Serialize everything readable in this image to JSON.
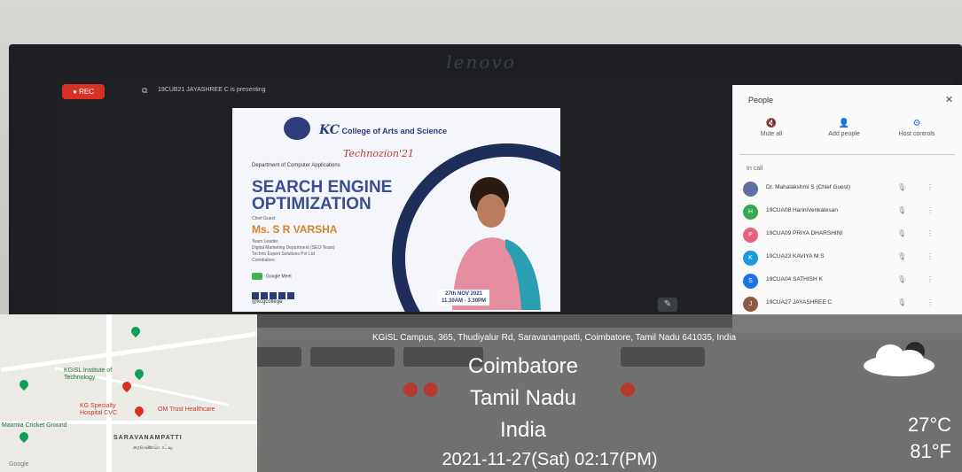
{
  "brand": "lenovo",
  "meet": {
    "rec_label": "● REC",
    "presenting_text": "19CUB21 JAYASHREE C is presenting"
  },
  "poster": {
    "college_short": "KC",
    "college_name": "College of Arts and Science",
    "event": "Technozion'21",
    "department": "Department of Computer Applications",
    "title_line1": "SEARCH ENGINE",
    "title_line2": "OPTIMIZATION",
    "chief_guest_label": "Chief Guest",
    "speaker": "Ms. S R VARSHA",
    "speaker_role": "Team Leader",
    "speaker_detail1": "Digital Marketing Department (SEO Team)",
    "speaker_detail2": "Techno Expert Solutions Pvt Ltd",
    "speaker_city": "Coimbatore",
    "platform": "Google Meet",
    "handle": "@kcgcollege",
    "date": "27th NOV 2021",
    "time": "11.30AM - 3.30PM"
  },
  "people_panel": {
    "title": "People",
    "actions": [
      {
        "icon": "mute-all-icon",
        "label": "Mute all"
      },
      {
        "icon": "add-people-icon",
        "label": "Add people"
      },
      {
        "icon": "host-controls-icon",
        "label": "Host controls"
      }
    ],
    "section_label": "In call",
    "participants": [
      {
        "name": "Dr. Mahalakshmi S (Chief Guest)",
        "initial": "",
        "color": "#5f6f9f"
      },
      {
        "name": "19CUA08 HariniVenkatesan",
        "initial": "H",
        "color": "#33a852"
      },
      {
        "name": "19CUA09 PRIYA DHARSHINI",
        "initial": "P",
        "color": "#e8627c"
      },
      {
        "name": "19CUA23 KAVIYA M S",
        "initial": "K",
        "color": "#1a9bd7"
      },
      {
        "name": "19CUA04 SATHISH K",
        "initial": "S",
        "color": "#1a73e8"
      },
      {
        "name": "19CUA27 JAYASHREE C",
        "initial": "J",
        "color": "#8a5a44"
      }
    ]
  },
  "map": {
    "labels": {
      "institute": "KGiSL Institute of Technology",
      "hospital": "KG Specialty Hospital CVC",
      "clinic": "OM Trust Healthcare",
      "ground": "Maxmia Cricket Ground",
      "area": "SARAVANAMPATTI",
      "area_local": "சரவணம்பட்டி",
      "provider": "Google"
    }
  },
  "geo": {
    "address": "KGiSL Campus, 365, Thudiyalur Rd, Saravanampatti, Coimbatore, Tamil Nadu 641035, India",
    "city": "Coimbatore",
    "state": "Tamil Nadu",
    "country": "India",
    "datetime": "2021-11-27(Sat)   02:17(PM)",
    "temp_c": "27°C",
    "temp_f": "81°F",
    "weather_icon": "partly-cloudy-icon"
  }
}
